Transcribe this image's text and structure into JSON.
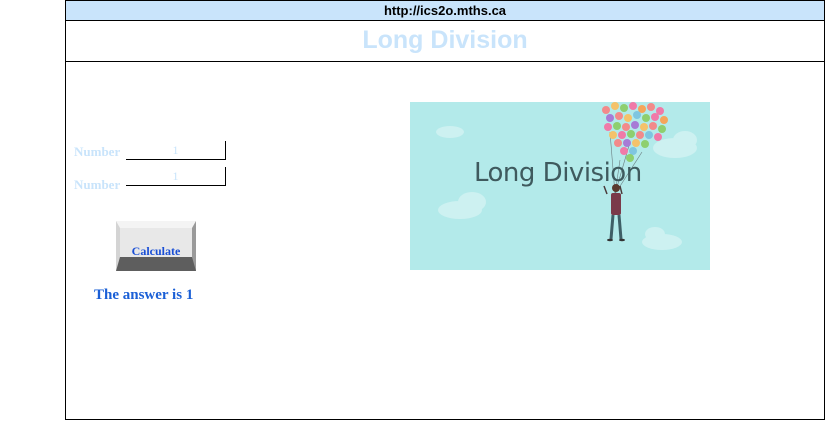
{
  "browser": {
    "url": "http://ics2o.mths.ca"
  },
  "page": {
    "title": "Long Division"
  },
  "form": {
    "fields": [
      {
        "label": "Number",
        "value": "1"
      },
      {
        "label": "Number",
        "value": "1"
      }
    ],
    "calculate_label": "Calculate",
    "answer_text": "The answer is 1"
  },
  "banner": {
    "title": "Long Division",
    "icon": "balloons-illustration"
  },
  "colors": {
    "accent_light_blue": "#c9e4fb",
    "answer_blue": "#1a5fd6",
    "banner_bg": "#b3eaea"
  }
}
